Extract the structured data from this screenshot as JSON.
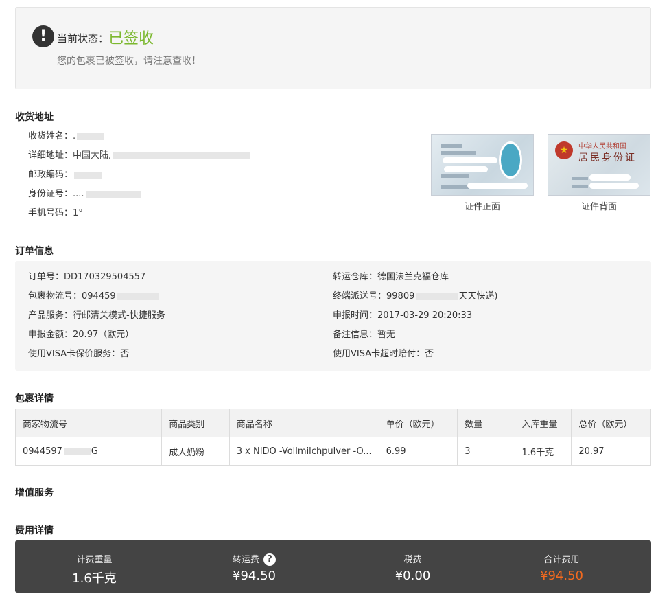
{
  "status": {
    "label": "当前状态：",
    "value": "已签收",
    "message": "您的包裹已被签收，请注意查收！",
    "icon": "exclamation-icon",
    "value_color": "#7cb82f"
  },
  "address": {
    "title": "收货地址",
    "rows": [
      {
        "label": "收货姓名：",
        "value": "."
      },
      {
        "label": "详细地址：",
        "value": "中国大陆,"
      },
      {
        "label": "邮政编码：",
        "value": ""
      },
      {
        "label": "身份证号：",
        "value": "...."
      },
      {
        "label": "手机号码：",
        "value": "1°"
      }
    ],
    "id_front_caption": "证件正面",
    "id_back_caption": "证件背面",
    "id_back_title": "中华人民共和国",
    "id_back_subtitle": "居民身份证"
  },
  "order": {
    "title": "订单信息",
    "left": [
      {
        "label": "订单号：",
        "value": "DD170329504557"
      },
      {
        "label": "包裹物流号：",
        "value": "094459"
      },
      {
        "label": "产品服务：",
        "value": "行邮清关模式-快捷服务"
      },
      {
        "label": "申报金额：",
        "value": "20.97（欧元）"
      },
      {
        "label": "使用VISA卡保价服务：",
        "value": "否"
      }
    ],
    "right": [
      {
        "label": "转运仓库：",
        "value": "德国法兰克福仓库"
      },
      {
        "label": "终端派送号：",
        "value": "99809",
        "suffix": "天天快递)"
      },
      {
        "label": "申报时间：",
        "value": "2017-03-29 20:20:33"
      },
      {
        "label": "备注信息：",
        "value": "暂无"
      },
      {
        "label": "使用VISA卡超时赔付：",
        "value": "否"
      }
    ]
  },
  "package": {
    "title": "包裹详情",
    "headers": [
      "商家物流号",
      "商品类别",
      "商品名称",
      "单价（欧元）",
      "数量",
      "入库重量",
      "总价（欧元）"
    ],
    "rows": [
      [
        "0944597",
        "成人奶粉",
        "3 x NIDO -Vollmilchpulver -O...",
        "6.99",
        "3",
        "1.6千克",
        "20.97"
      ]
    ],
    "row0_tail": "G"
  },
  "value_added": {
    "title": "增值服务"
  },
  "fees": {
    "title": "费用详情",
    "items": [
      {
        "label": "计费重量",
        "value": "1.6千克"
      },
      {
        "label": "转运费",
        "value": "¥94.50",
        "icon": "question-mark-icon"
      },
      {
        "label": "税费",
        "value": "¥0.00"
      },
      {
        "label": "合计费用",
        "value": "¥94.50",
        "color": "#f36a1f"
      }
    ],
    "bar_color": "#444444"
  }
}
